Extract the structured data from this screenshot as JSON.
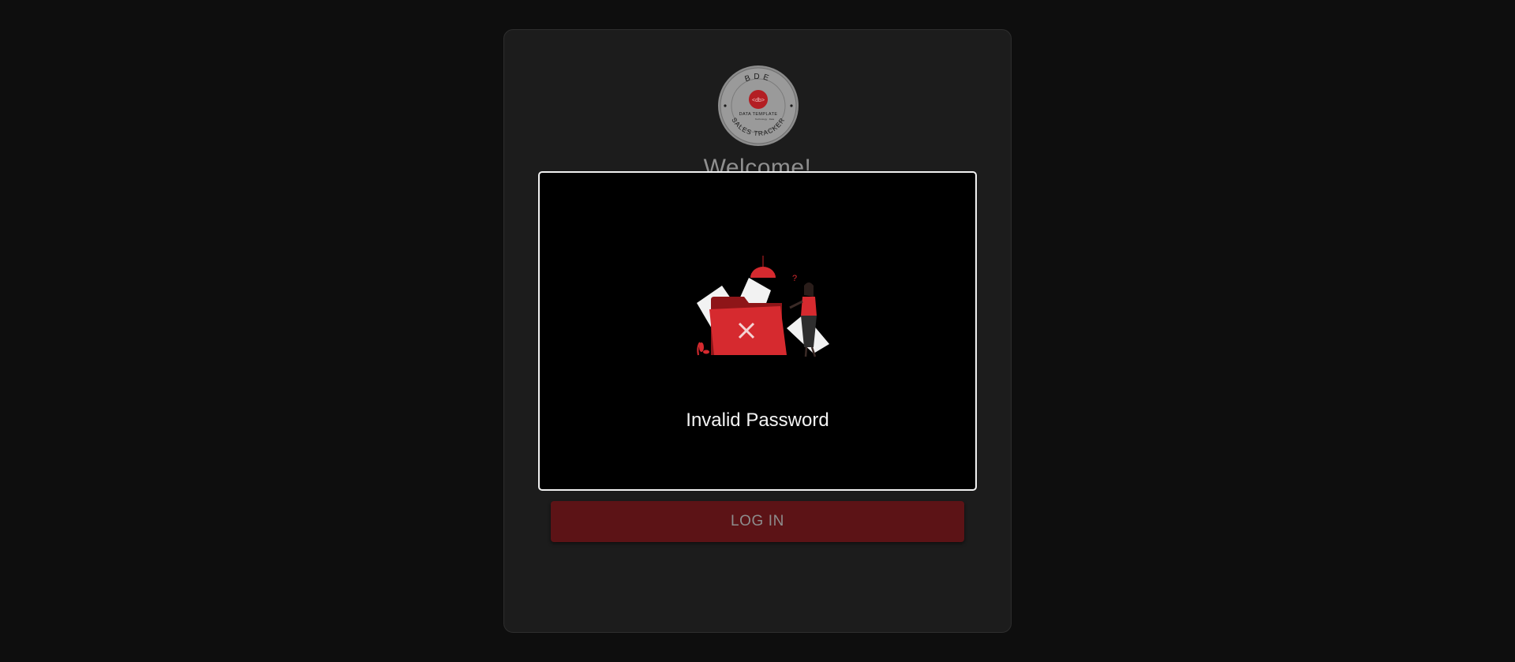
{
  "logo": {
    "top_text": "BDE",
    "center_text": "DATA TEMPLATE",
    "small_text": "Technology · Data",
    "bottom_text": "SALES TRACKER"
  },
  "login": {
    "welcome": "Welcome!",
    "button_label": "LOG IN"
  },
  "modal": {
    "message": "Invalid Password",
    "illustration": "error-folder-illustration"
  },
  "colors": {
    "background": "#0e0e0e",
    "card": "#1c1c1c",
    "accent_red": "#d62a2f",
    "button_dim_red": "#5c1316",
    "modal_bg": "#000000",
    "modal_border": "#f1f1f1"
  }
}
